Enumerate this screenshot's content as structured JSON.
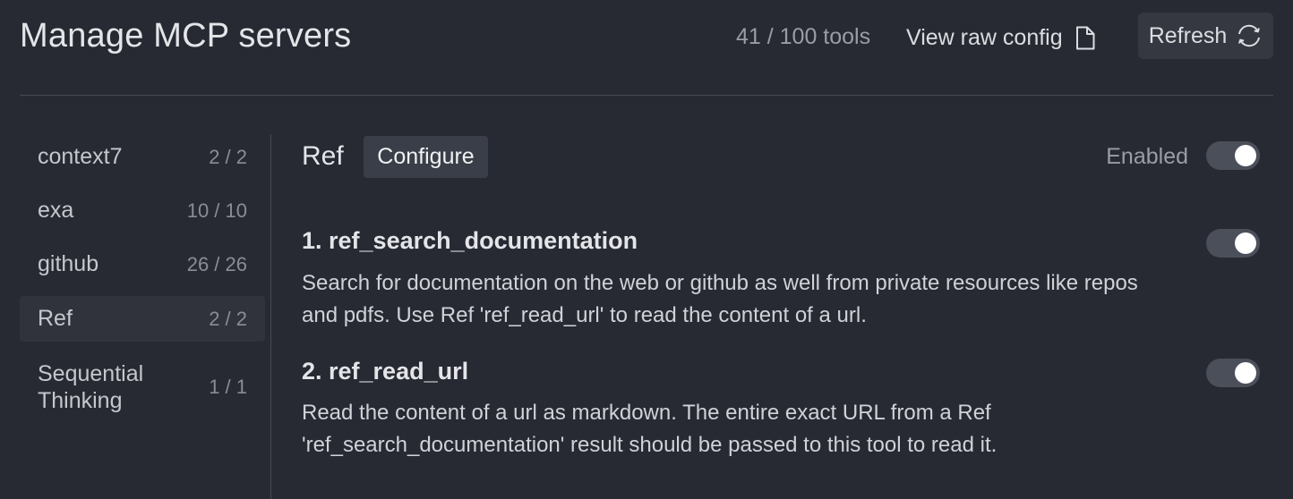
{
  "header": {
    "title": "Manage MCP servers",
    "tool_count": "41 / 100 tools",
    "raw_config_label": "View raw config",
    "raw_config_icon": "file-icon",
    "refresh_label": "Refresh",
    "refresh_icon": "refresh-icon"
  },
  "sidebar": {
    "items": [
      {
        "label": "context7",
        "count": "2 / 2"
      },
      {
        "label": "exa",
        "count": "10 / 10"
      },
      {
        "label": "github",
        "count": "26 / 26"
      },
      {
        "label": "Ref",
        "count": "2 / 2",
        "active": true
      },
      {
        "label_line1": "Sequential",
        "label_line2": "Thinking",
        "count": "1 / 1"
      }
    ]
  },
  "main": {
    "server_name": "Ref",
    "configure_label": "Configure",
    "enabled_label": "Enabled",
    "enabled": true,
    "tools": [
      {
        "title": "1. ref_search_documentation",
        "desc_line1": "Search for documentation on the web or github as well from private resources like repos",
        "desc_line2": "and pdfs. Use Ref 'ref_read_url' to read the content of a url.",
        "enabled": true
      },
      {
        "title": "2. ref_read_url",
        "desc_line1": "Read the content of a url as markdown. The entire exact URL from a Ref",
        "desc_line2": "'ref_search_documentation' result should be passed to this tool to read it.",
        "enabled": true
      }
    ]
  },
  "colors": {
    "background": "#272a33",
    "active_item": "#30333c",
    "button": "#353841",
    "toggle_track": "#4b4f5a"
  }
}
